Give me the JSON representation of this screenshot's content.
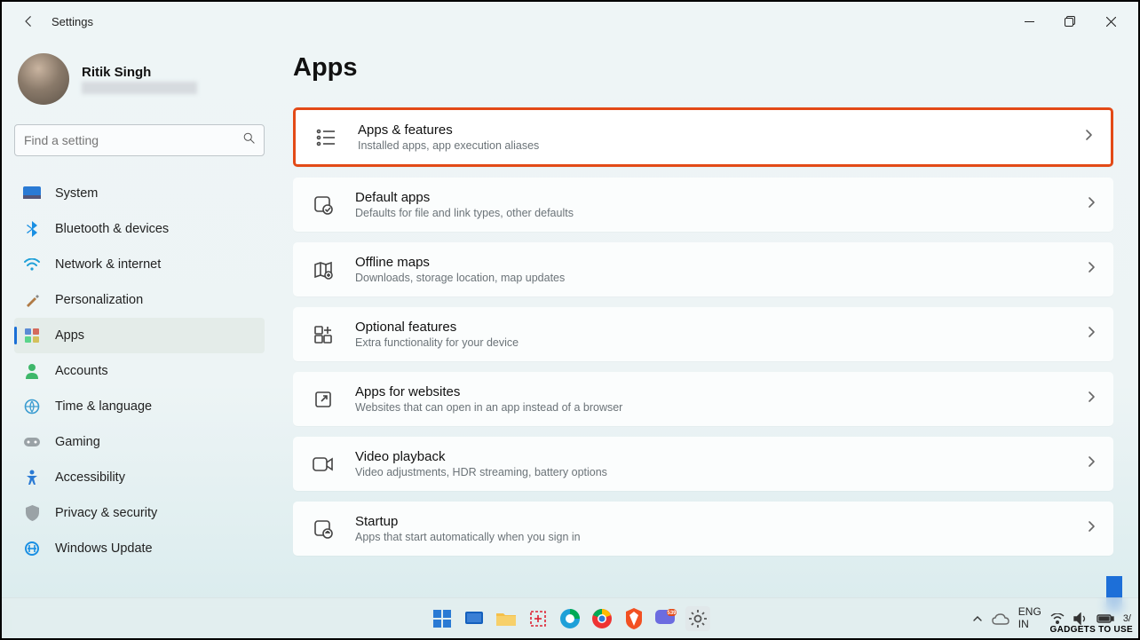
{
  "window": {
    "title": "Settings"
  },
  "profile": {
    "name": "Ritik Singh"
  },
  "search": {
    "placeholder": "Find a setting"
  },
  "nav": {
    "items": [
      {
        "label": "System"
      },
      {
        "label": "Bluetooth & devices"
      },
      {
        "label": "Network & internet"
      },
      {
        "label": "Personalization"
      },
      {
        "label": "Apps"
      },
      {
        "label": "Accounts"
      },
      {
        "label": "Time & language"
      },
      {
        "label": "Gaming"
      },
      {
        "label": "Accessibility"
      },
      {
        "label": "Privacy & security"
      },
      {
        "label": "Windows Update"
      }
    ]
  },
  "page": {
    "title": "Apps"
  },
  "cards": [
    {
      "title": "Apps & features",
      "sub": "Installed apps, app execution aliases"
    },
    {
      "title": "Default apps",
      "sub": "Defaults for file and link types, other defaults"
    },
    {
      "title": "Offline maps",
      "sub": "Downloads, storage location, map updates"
    },
    {
      "title": "Optional features",
      "sub": "Extra functionality for your device"
    },
    {
      "title": "Apps for websites",
      "sub": "Websites that can open in an app instead of a browser"
    },
    {
      "title": "Video playback",
      "sub": "Video adjustments, HDR streaming, battery options"
    },
    {
      "title": "Startup",
      "sub": "Apps that start automatically when you sign in"
    }
  ],
  "tray": {
    "lang_top": "ENG",
    "lang_bottom": "IN",
    "time": "3/"
  },
  "watermark": "GADGETS TO USE"
}
